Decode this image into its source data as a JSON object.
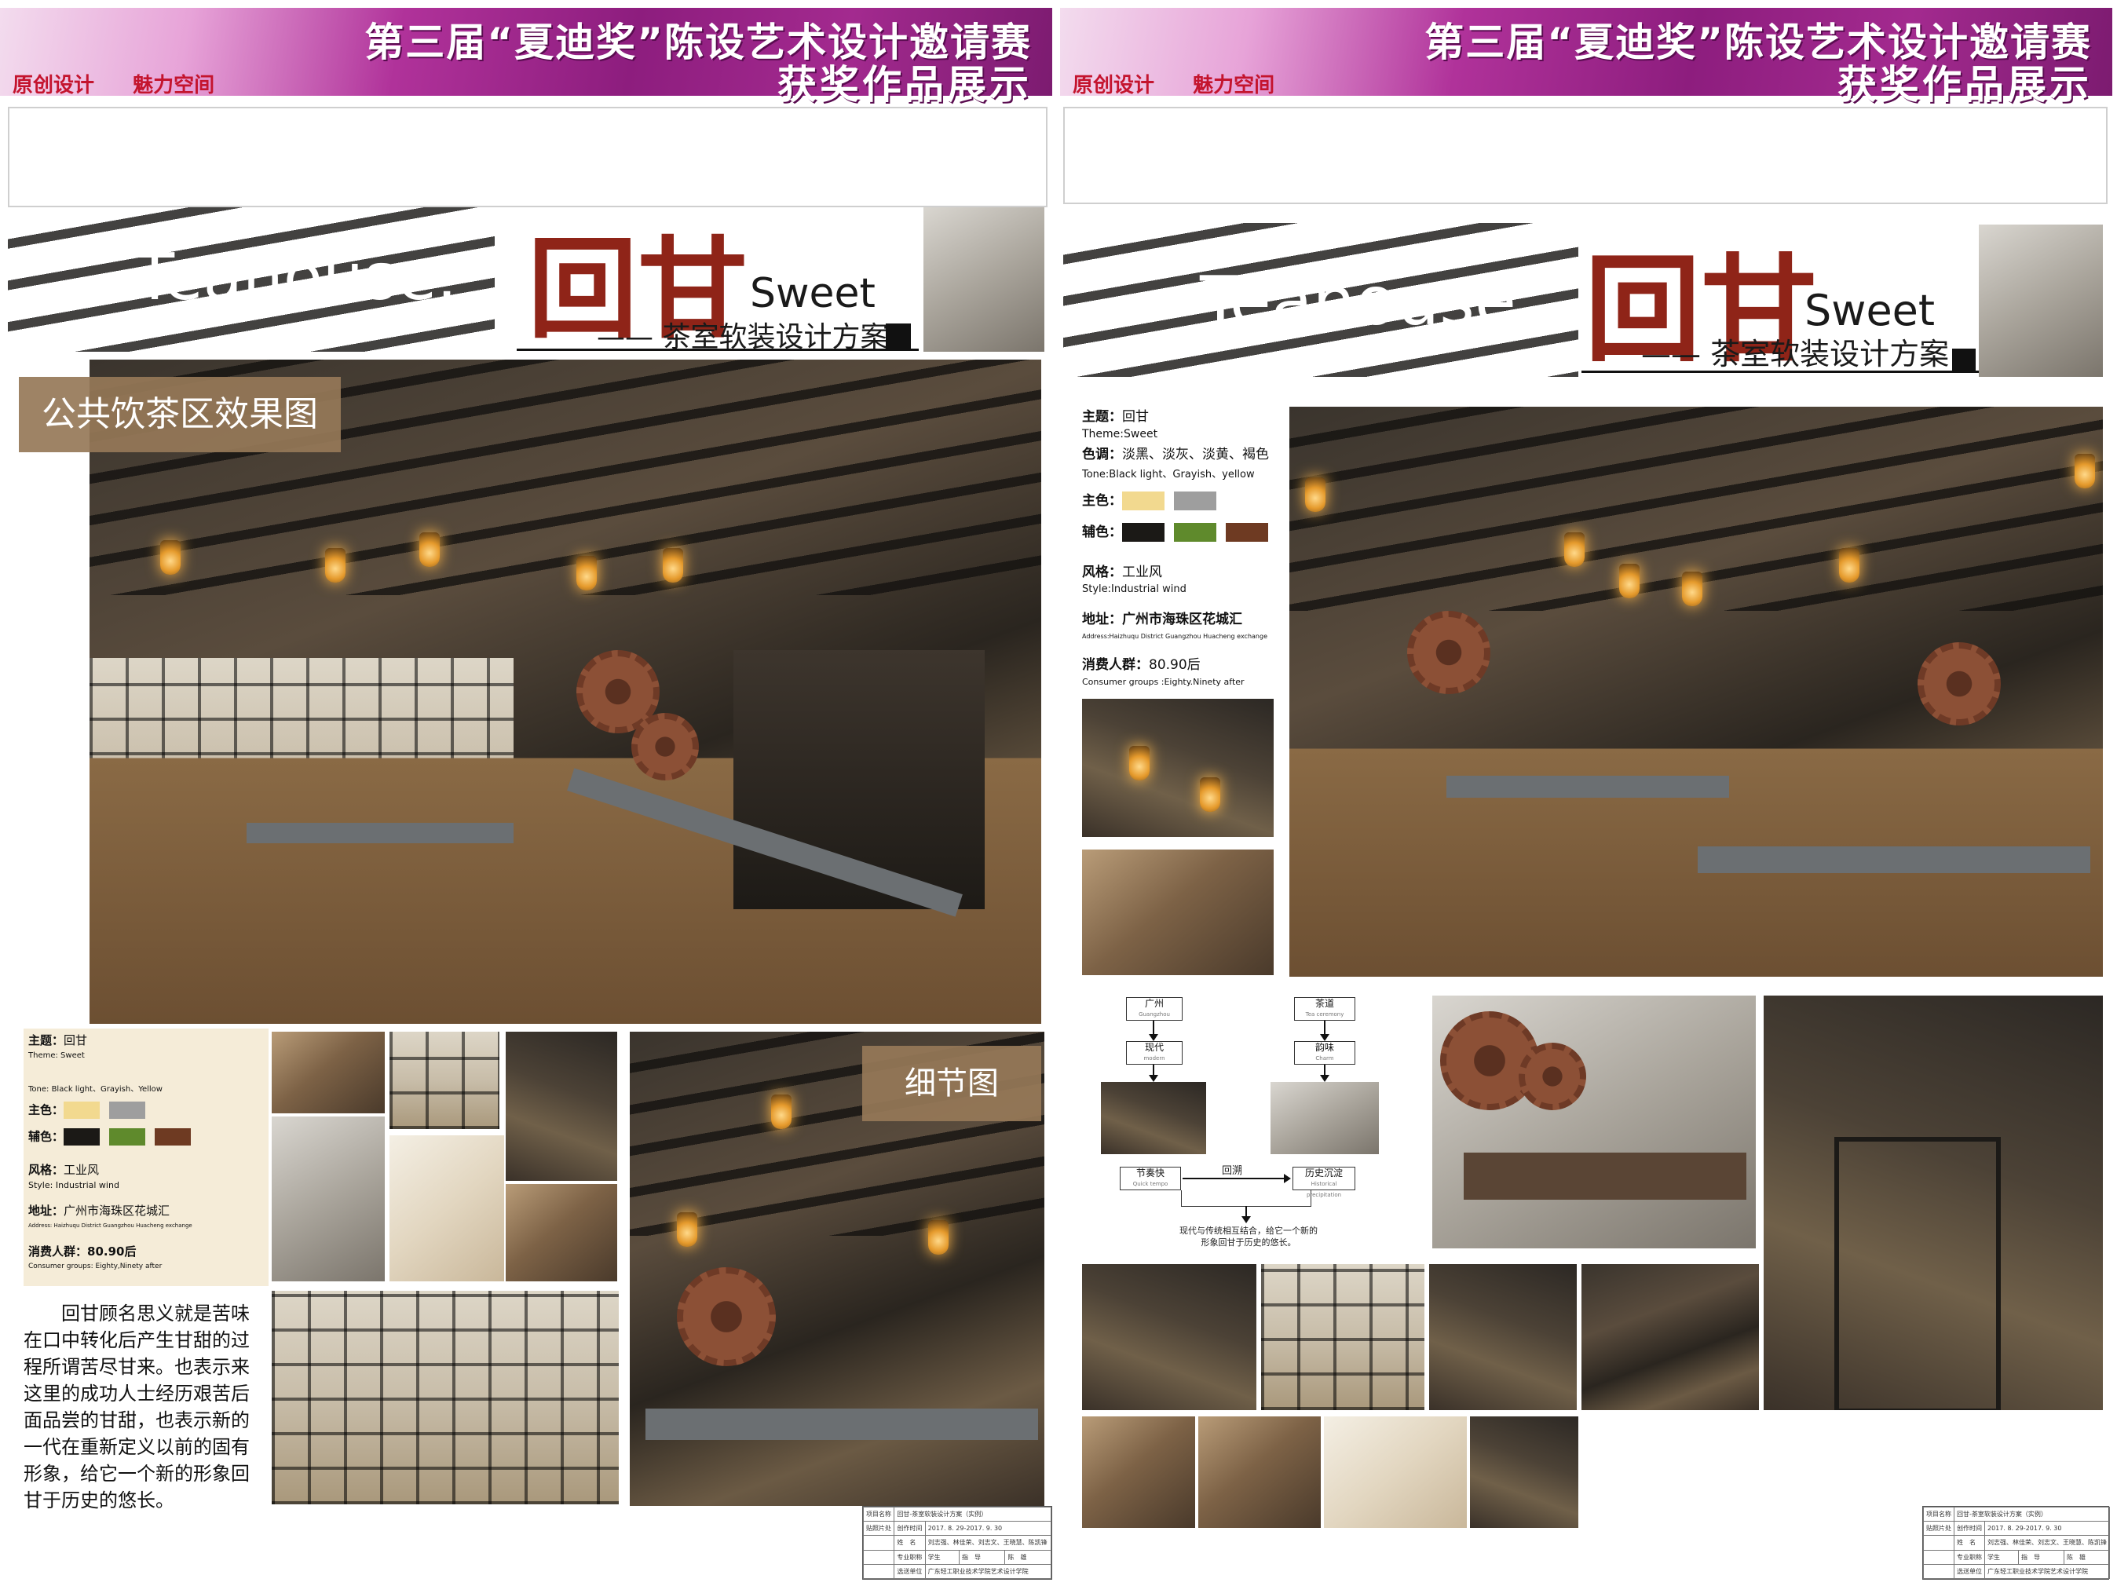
{
  "banner": {
    "line1": "第三届“夏迪奖”陈设艺术设计邀请赛",
    "line2": "获奖作品展示",
    "tag1": "原创设计",
    "tag2": "魅力空间"
  },
  "title": {
    "english": "Teahouse.",
    "chinese": "回甘",
    "sweet": "Sweet",
    "subtitle": "—— 茶室软装设计方案"
  },
  "left_board": {
    "caption_main": "公共饮茶区效果图",
    "caption_detail": "细节图",
    "info": {
      "theme_label": "主题：",
      "theme_value": "回甘",
      "theme_en": "Theme:  Sweet",
      "tone": "Tone:  Black light、Grayish、Yellow",
      "main_color_label": "主色：",
      "aux_color_label": "辅色：",
      "style_label": "风格：",
      "style_value": "工业风",
      "style_en": "Style:  Industrial wind",
      "address_label": "地址：",
      "address_value": "广州市海珠区花城汇",
      "address_en": "Address: Haizhuqu District Guangzhou Huacheng exchange",
      "consumer_label": "消费人群：",
      "consumer_value": "80.90后",
      "consumer_en": "Consumer groups:  Eighty,Ninety after"
    },
    "description": "回甘顾名思义就是苦味在口中转化后产生甘甜的过程所谓苦尽甘来。也表示来这里的成功人士经历艰苦后面品尝的甘甜，也表示新的一代在重新定义以前的固有形象，给它一个新的形象回甘于历史的悠长。"
  },
  "right_board": {
    "info": {
      "theme_label": "主题：",
      "theme_value": "回甘",
      "theme_en": "Theme:Sweet",
      "color_label": "色调：",
      "color_value": "淡黑、淡灰、淡黄、褐色",
      "tone_en": "Tone:Black light、Grayish、yellow",
      "main_color_label": "主色：",
      "aux_color_label": "辅色：",
      "style_label": "风格：",
      "style_value": "工业风",
      "style_en": "Style:Industrial wind",
      "address_label": "地址：",
      "address_value": "广州市海珠区花城汇",
      "address_en": "Address:Haizhuqu District Guangzhou Huacheng exchange",
      "consumer_label": "消费人群：",
      "consumer_value": "80.90后",
      "consumer_en": "Consumer groups :Eighty.Ninety after"
    },
    "flow": {
      "guangzhou": "广州",
      "guangzhou_en": "Guangzhou",
      "modern": "现代",
      "modern_en": "modern",
      "tea": "茶道",
      "tea_en": "Tea ceremony",
      "charm": "韵味",
      "charm_en": "Charm",
      "fast": "节奏快",
      "fast_en": "Quick tempo",
      "back": "回溯",
      "history": "历史沉淀",
      "history_en": "Historical precipitation",
      "note": "现代与传统相互结合，给它一个新的形象回甘于历史的悠长。"
    }
  },
  "colors": {
    "main": [
      "#f2d98f",
      "#9e9e9e"
    ],
    "aux": [
      "#1b1916",
      "#5f8a2c",
      "#6e3a22"
    ],
    "brand_red": "#8f2418",
    "caption_bg": "#967858"
  },
  "table": {
    "project_label": "项目名称",
    "project_value": "回甘-茶室软装设计方案（实例）",
    "time_label": "创作时间",
    "time_value": "2017. 8. 29-2017. 9. 30",
    "names_label": "姓　名",
    "names_value": "刘志强、林佳荣、刘志文、王晓慧、陈凯锋",
    "major_label": "专业职称",
    "major_value": "学生",
    "advisor_label": "指　导",
    "advisor_value": "陈　雄",
    "unit_label": "选送单位",
    "unit_value": "广东轻工职业技术学院艺术设计学院",
    "side_label": "贴照片处"
  }
}
